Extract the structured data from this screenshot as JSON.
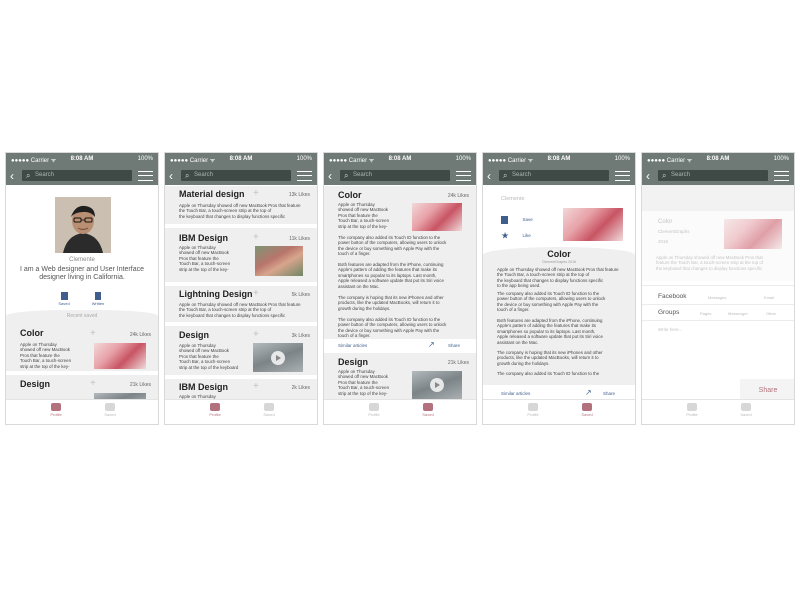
{
  "status": {
    "carrier": "●●●●● Carrier ᯤ",
    "time": "8:08 AM",
    "battery": "100%"
  },
  "nav": {
    "search_placeholder": "Search"
  },
  "tabs": {
    "profile": "Profile",
    "saved": "Saved"
  },
  "profile": {
    "name": "Clemente",
    "bio_line1": "I am a Web designer and User Interface",
    "bio_line2": "designer living in California.",
    "saved_label": "Saved",
    "written_label": "Written",
    "section_title": "Recent saved"
  },
  "articles": {
    "color": {
      "title": "Color",
      "likes": "24k Likes"
    },
    "design_21k": {
      "title": "Design",
      "likes": "21k Likes"
    },
    "material": {
      "title": "Material design",
      "likes": "13k Likes"
    },
    "ibm_11k": {
      "title": "IBM Design",
      "likes": "11k Likes"
    },
    "lightning": {
      "title": "Lightning Design",
      "likes": "5k Likes"
    },
    "design_3k": {
      "title": "Design",
      "likes": "3k Likes"
    },
    "ibm_2k": {
      "title": "IBM Design",
      "likes": "2k Likes"
    }
  },
  "snippets": {
    "narrow1": "Apple on Thursday",
    "narrow2": "showed off new MacBook",
    "narrow3": "Pros that feature the",
    "narrow4": "Touch Bar, a touch-screen",
    "narrow5": "strip at the top of the key-",
    "narrow6": "strip at the top of the keyboard",
    "narrow7": "strip at the top of the keyboard",
    "wide1": "Apple on Thursday showed off new MacBook Pros that feature",
    "wide2": "the Touch Bar, a touch-screen strip at the top of",
    "wide3": "the keyboard that changes to display functions specific"
  },
  "detail": {
    "p1": [
      "Apple on Thursday",
      "showed off new MacBook",
      "Pros that feature the",
      "Touch Bar, a touch-screen",
      "strip at the top of the key-"
    ],
    "p2": [
      "The company also added its Touch ID function to the",
      "power button of the computers, allowing users to unlock",
      "the device or buy something with Apple Pay with the",
      "touch of a finger."
    ],
    "p3": [
      "Both features are adapted from the iPhone, continuing",
      "Apple's pattern of adding the features that make its",
      "smartphones so popular to its laptops. Last month,",
      "Apple released a software update that put its Siri voice",
      "assistant on the Mac."
    ],
    "p4": [
      "The company is hoping that its new iPhones and other",
      "products, like the updated MacBooks, will return it to",
      "growth during the holidays."
    ],
    "p5": [
      "The company also added its Touch ID function to the",
      "power button of the computers, allowing users to unlock",
      "the device or buy something with Apple Pay with the",
      "touch of a finger."
    ],
    "similar": "Similar articles",
    "share": "Share",
    "design_title": "Design",
    "design_likes": "21k Likes",
    "design_text": [
      "Apple on Thursday",
      "showed off new MacBook",
      "Pros that feature the",
      "Touch Bar, a touch-screen",
      "strip at the top of the key-"
    ]
  },
  "screen4": {
    "author": "Clemente",
    "save": "Save",
    "like": "Like",
    "title": "Color",
    "meta": "ClementGraphs    2016",
    "intro": [
      "Apple on Thursday showed off new MacBook Pros that feature",
      "the Touch Bar, a touch-screen strip at the top of",
      "the keyboard that changes to display functions specific",
      "to the app being used."
    ],
    "last": "The company also added its Touch ID function to the"
  },
  "screen5": {
    "title": "Color",
    "author": "ClementGraphs",
    "year": "2016",
    "intro": [
      "Apple on Thursday showed off new MacBook Pros that",
      "feature the Touch Bar, a touch-screen strip at the top of",
      "the keyboard that changes to display functions specific"
    ],
    "facebook": "Facebook",
    "messages": "Messages",
    "email": "Email",
    "groups": "Groups",
    "pages": "Pages",
    "messenger": "Messenger",
    "other": "Other",
    "write_placeholder": "Write here...",
    "share": "Share"
  }
}
